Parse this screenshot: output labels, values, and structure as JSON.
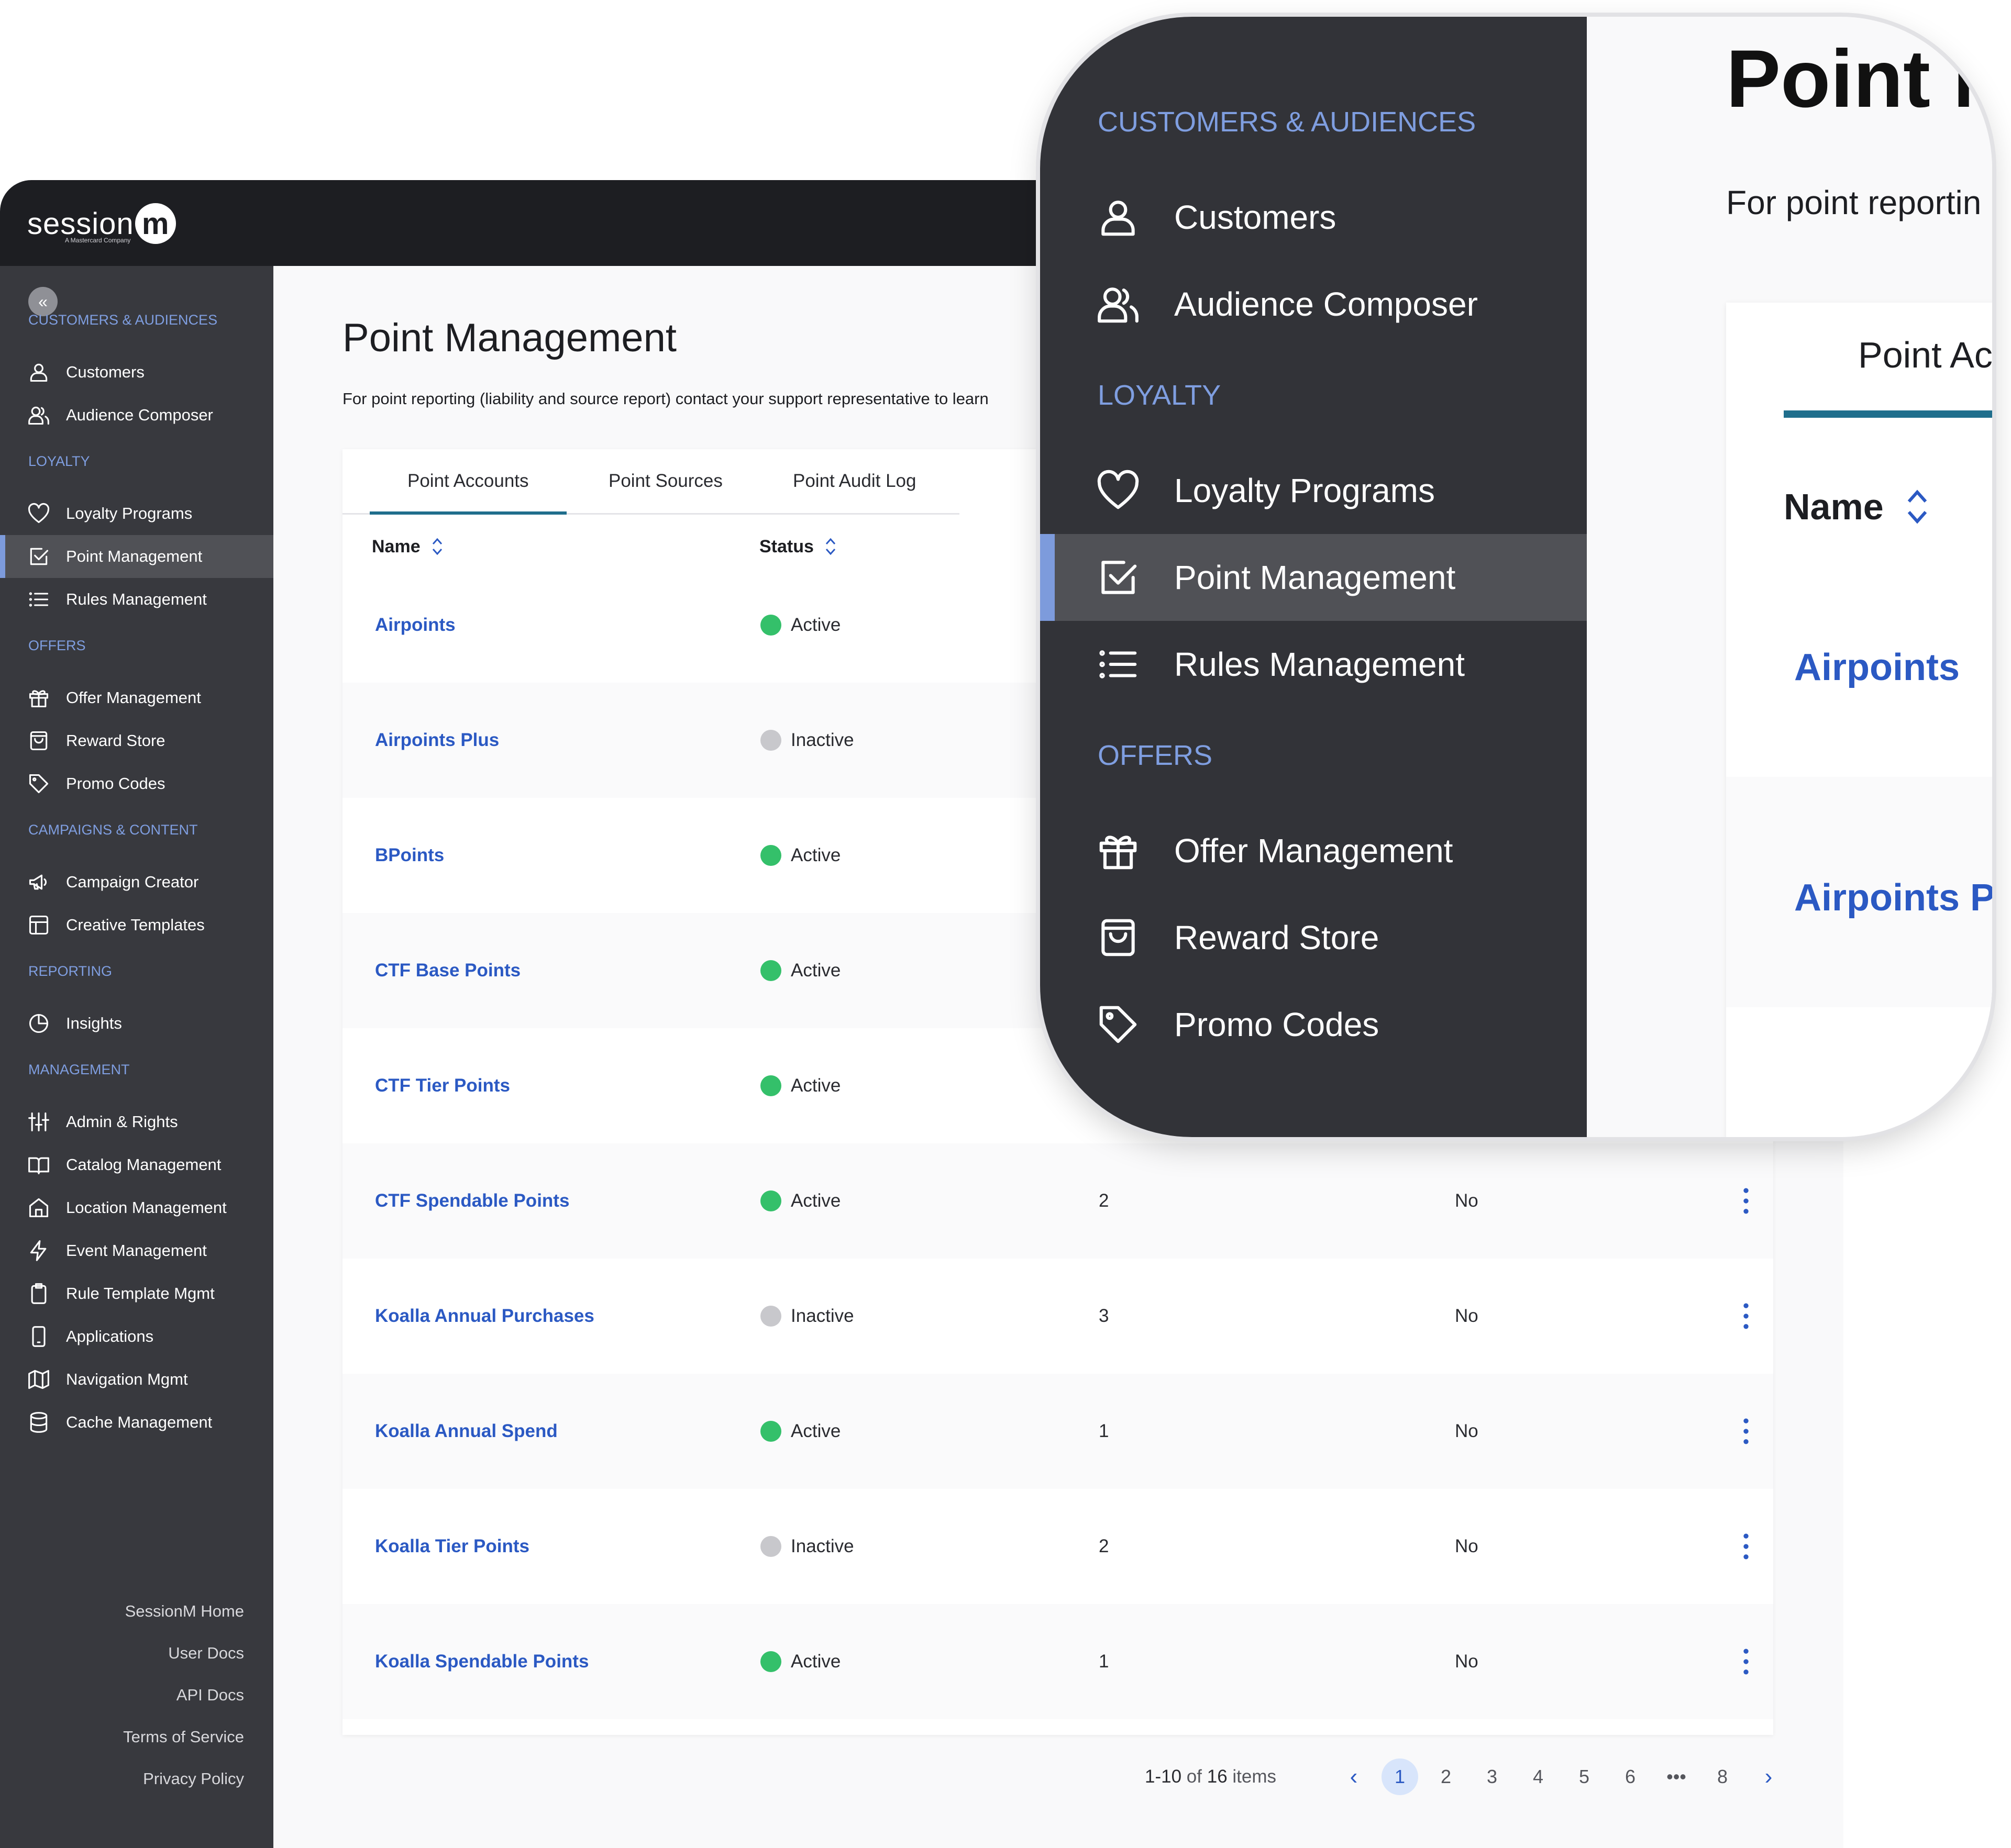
{
  "brand": {
    "logo_text": "session",
    "logo_mark": "m",
    "logo_sub": "A Mastercard Company"
  },
  "sidebar": {
    "sections": [
      {
        "label": "CUSTOMERS & AUDIENCES",
        "items": [
          {
            "label": "Customers",
            "icon": "user-icon"
          },
          {
            "label": "Audience Composer",
            "icon": "users-icon"
          }
        ]
      },
      {
        "label": "LOYALTY",
        "items": [
          {
            "label": "Loyalty Programs",
            "icon": "heart-icon"
          },
          {
            "label": "Point Management",
            "icon": "checkbox-icon",
            "active": true
          },
          {
            "label": "Rules Management",
            "icon": "list-icon"
          }
        ]
      },
      {
        "label": "OFFERS",
        "items": [
          {
            "label": "Offer Management",
            "icon": "gift-icon"
          },
          {
            "label": "Reward Store",
            "icon": "bag-icon"
          },
          {
            "label": "Promo Codes",
            "icon": "tag-icon"
          }
        ]
      },
      {
        "label": "CAMPAIGNS & CONTENT",
        "items": [
          {
            "label": "Campaign Creator",
            "icon": "megaphone-icon"
          },
          {
            "label": "Creative Templates",
            "icon": "template-icon"
          }
        ]
      },
      {
        "label": "REPORTING",
        "items": [
          {
            "label": "Insights",
            "icon": "clock-chart-icon"
          }
        ]
      },
      {
        "label": "MANAGEMENT",
        "items": [
          {
            "label": "Admin & Rights",
            "icon": "sliders-icon"
          },
          {
            "label": "Catalog Management",
            "icon": "book-icon"
          },
          {
            "label": "Location Management",
            "icon": "home-icon"
          },
          {
            "label": "Event Management",
            "icon": "bolt-icon"
          },
          {
            "label": "Rule Template Mgmt",
            "icon": "clipboard-icon"
          },
          {
            "label": "Applications",
            "icon": "phone-icon"
          },
          {
            "label": "Navigation Mgmt",
            "icon": "map-icon"
          },
          {
            "label": "Cache Management",
            "icon": "database-icon"
          }
        ]
      }
    ],
    "footer_links": [
      "SessionM Home",
      "User Docs",
      "API Docs",
      "Terms of Service",
      "Privacy Policy"
    ]
  },
  "main": {
    "title": "Point Management",
    "subtitle": "For point reporting (liability and source report) contact your support representative to learn",
    "tabs": [
      {
        "label": "Point Accounts",
        "active": true
      },
      {
        "label": "Point Sources"
      },
      {
        "label": "Point Audit Log"
      }
    ],
    "columns": [
      "Name",
      "Status"
    ],
    "rows": [
      {
        "name": "Airpoints",
        "status": "Active",
        "num": "",
        "flag": ""
      },
      {
        "name": "Airpoints Plus",
        "status": "Inactive",
        "num": "",
        "flag": ""
      },
      {
        "name": "BPoints",
        "status": "Active",
        "num": "",
        "flag": ""
      },
      {
        "name": "CTF Base Points",
        "status": "Active",
        "num": "",
        "flag": ""
      },
      {
        "name": "CTF Tier Points",
        "status": "Active",
        "num": "",
        "flag": ""
      },
      {
        "name": "CTF Spendable Points",
        "status": "Active",
        "num": "2",
        "flag": "No"
      },
      {
        "name": "Koalla Annual Purchases",
        "status": "Inactive",
        "num": "3",
        "flag": "No"
      },
      {
        "name": "Koalla Annual Spend",
        "status": "Active",
        "num": "1",
        "flag": "No"
      },
      {
        "name": "Koalla Tier Points",
        "status": "Inactive",
        "num": "2",
        "flag": "No"
      },
      {
        "name": "Koalla Spendable Points",
        "status": "Active",
        "num": "1",
        "flag": "No"
      }
    ],
    "pagination": {
      "range": "1-10",
      "of": "of",
      "total": "16",
      "unit": "items",
      "pages": [
        "1",
        "2",
        "3",
        "4",
        "5",
        "6",
        "•••",
        "8"
      ],
      "current": "1"
    }
  },
  "zoom": {
    "sections": [
      {
        "label": "CUSTOMERS & AUDIENCES",
        "items": [
          {
            "label": "Customers",
            "icon": "user-icon"
          },
          {
            "label": "Audience Composer",
            "icon": "users-icon"
          }
        ]
      },
      {
        "label": "LOYALTY",
        "items": [
          {
            "label": "Loyalty Programs",
            "icon": "heart-icon"
          },
          {
            "label": "Point Management",
            "icon": "checkbox-icon",
            "active": true
          },
          {
            "label": "Rules Management",
            "icon": "list-icon"
          }
        ]
      },
      {
        "label": "OFFERS",
        "items": [
          {
            "label": "Offer Management",
            "icon": "gift-icon"
          },
          {
            "label": "Reward Store",
            "icon": "bag-icon"
          },
          {
            "label": "Promo Codes",
            "icon": "tag-icon"
          }
        ]
      }
    ],
    "title": "Point M",
    "subtitle": "For point reportin",
    "tab": "Point Ac",
    "column": "Name",
    "rows": [
      "Airpoints",
      "Airpoints P"
    ]
  },
  "colors": {
    "accent": "#2b59c3",
    "active_green": "#34c06a",
    "inactive_gray": "#c8c8cc",
    "tab_underline": "#1f6e8c",
    "sidebar_bg": "#38393e",
    "section_label": "#7f9ee0"
  }
}
